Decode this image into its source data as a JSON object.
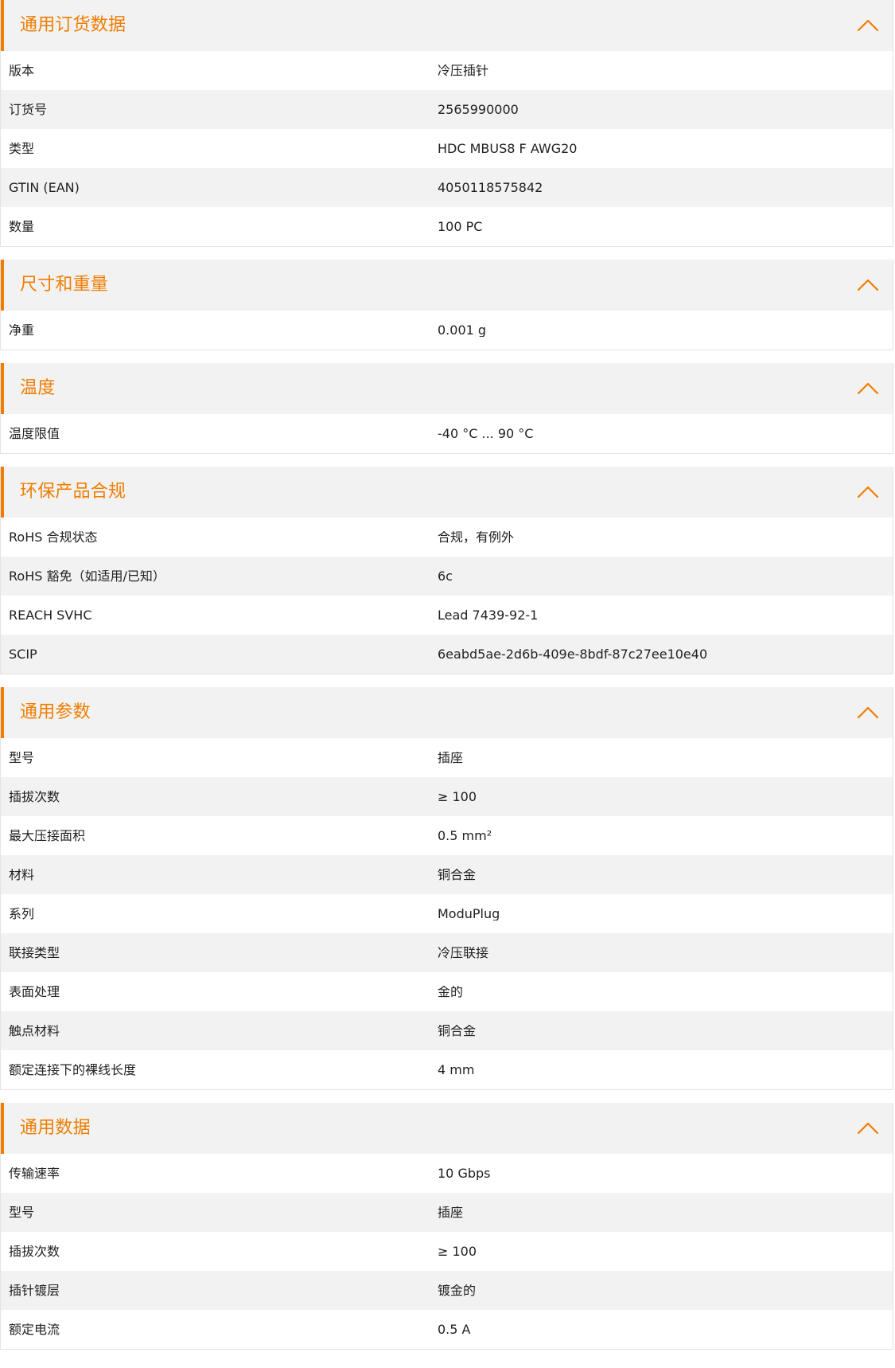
{
  "colors": {
    "accent": "#f07d00",
    "header_bg": "#f2f2f2",
    "row_gray": "#f2f2f2",
    "row_white": "#ffffff",
    "text": "#222222"
  },
  "icons": {
    "toggle": "chevron-up-icon"
  },
  "sections": [
    {
      "title": "通用订货数据",
      "rows": [
        {
          "label": "版本",
          "value": "冷压插针"
        },
        {
          "label": "订货号",
          "value": "2565990000"
        },
        {
          "label": "类型",
          "value": "HDC MBUS8 F AWG20"
        },
        {
          "label": "GTIN (EAN)",
          "value": "4050118575842"
        },
        {
          "label": "数量",
          "value": "100  PC"
        }
      ]
    },
    {
      "title": "尺寸和重量",
      "rows": [
        {
          "label": "净重",
          "value": "0.001  g"
        }
      ]
    },
    {
      "title": "温度",
      "rows": [
        {
          "label": "温度限值",
          "value": "-40 °C ... 90 °C"
        }
      ]
    },
    {
      "title": "环保产品合规",
      "rows": [
        {
          "label": "RoHS 合规状态",
          "value": "合规，有例外"
        },
        {
          "label": "RoHS 豁免（如适用/已知）",
          "value": "6c"
        },
        {
          "label": "REACH SVHC",
          "value": "Lead 7439-92-1"
        },
        {
          "label": "SCIP",
          "value": "6eabd5ae-2d6b-409e-8bdf-87c27ee10e40"
        }
      ]
    },
    {
      "title": "通用参数",
      "rows": [
        {
          "label": "型号",
          "value": "插座"
        },
        {
          "label": "插拔次数",
          "value": "≥ 100"
        },
        {
          "label": "最大压接面积",
          "value": "0.5  mm²"
        },
        {
          "label": "材料",
          "value": "铜合金"
        },
        {
          "label": "系列",
          "value": "ModuPlug"
        },
        {
          "label": "联接类型",
          "value": "冷压联接"
        },
        {
          "label": "表面处理",
          "value": "金的"
        },
        {
          "label": "触点材料",
          "value": "铜合金"
        },
        {
          "label": "额定连接下的裸线长度",
          "value": "4  mm"
        }
      ]
    },
    {
      "title": "通用数据",
      "rows": [
        {
          "label": "传输速率",
          "value": "10 Gbps"
        },
        {
          "label": "型号",
          "value": "插座"
        },
        {
          "label": "插拔次数",
          "value": "≥ 100"
        },
        {
          "label": "插针镀层",
          "value": "镀金的"
        },
        {
          "label": "额定电流",
          "value": "0.5  A"
        }
      ]
    }
  ]
}
